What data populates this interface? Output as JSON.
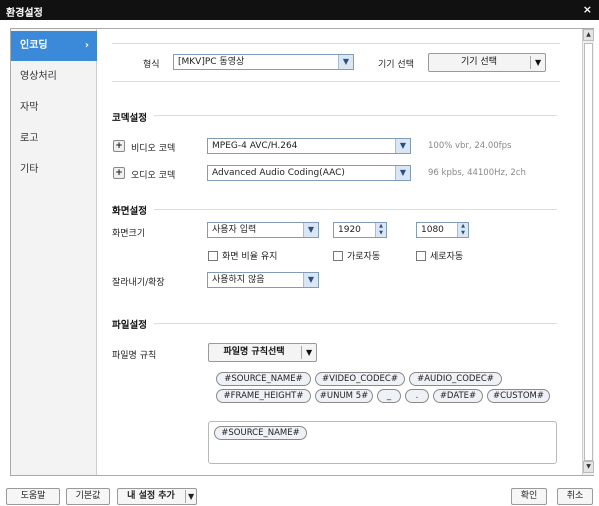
{
  "window": {
    "title": "환경설정",
    "close_icon": "×"
  },
  "sidebar": {
    "items": [
      {
        "label": "인코딩",
        "active": true
      },
      {
        "label": "영상처리"
      },
      {
        "label": "자막"
      },
      {
        "label": "로고"
      },
      {
        "label": "기타"
      }
    ]
  },
  "format": {
    "label": "형식",
    "value": "[MKV]PC 동영상",
    "device_label": "기기 선택",
    "device_button": "기기 선택"
  },
  "codec": {
    "section": "코덱설정",
    "video_label": "비디오 코덱",
    "video_value": "MPEG-4 AVC/H.264",
    "video_info": "100% vbr, 24.00fps",
    "audio_label": "오디오 코덱",
    "audio_value": "Advanced Audio Coding(AAC)",
    "audio_info": "96 kpbs, 44100Hz, 2ch"
  },
  "screen": {
    "section": "화면설정",
    "size_label": "화면크기",
    "size_value": "사용자 입력",
    "width": "1920",
    "height": "1080",
    "keep_ratio": "화면 비율 유지",
    "auto_width": "가로자동",
    "auto_height": "세로자동",
    "crop_label": "잘라내기/확장",
    "crop_value": "사용하지 않음"
  },
  "file": {
    "section": "파일설정",
    "rule_label": "파일명 규칙",
    "rule_button": "파일명 규칙선택",
    "tags": [
      "#SOURCE_NAME#",
      "#VIDEO_CODEC#",
      "#AUDIO_CODEC#",
      "#FRAME_HEIGHT#",
      "#UNUM 5#",
      "_",
      ".",
      "#DATE#",
      "#CUSTOM#"
    ],
    "selected_tags": [
      "#SOURCE_NAME#"
    ]
  },
  "footer": {
    "help": "도움말",
    "defaults": "기본값",
    "my_settings": "내 설정 추가",
    "ok": "확인",
    "cancel": "취소"
  },
  "colors": {
    "accent": "#3b8ad9",
    "titlebar": "#111111"
  }
}
